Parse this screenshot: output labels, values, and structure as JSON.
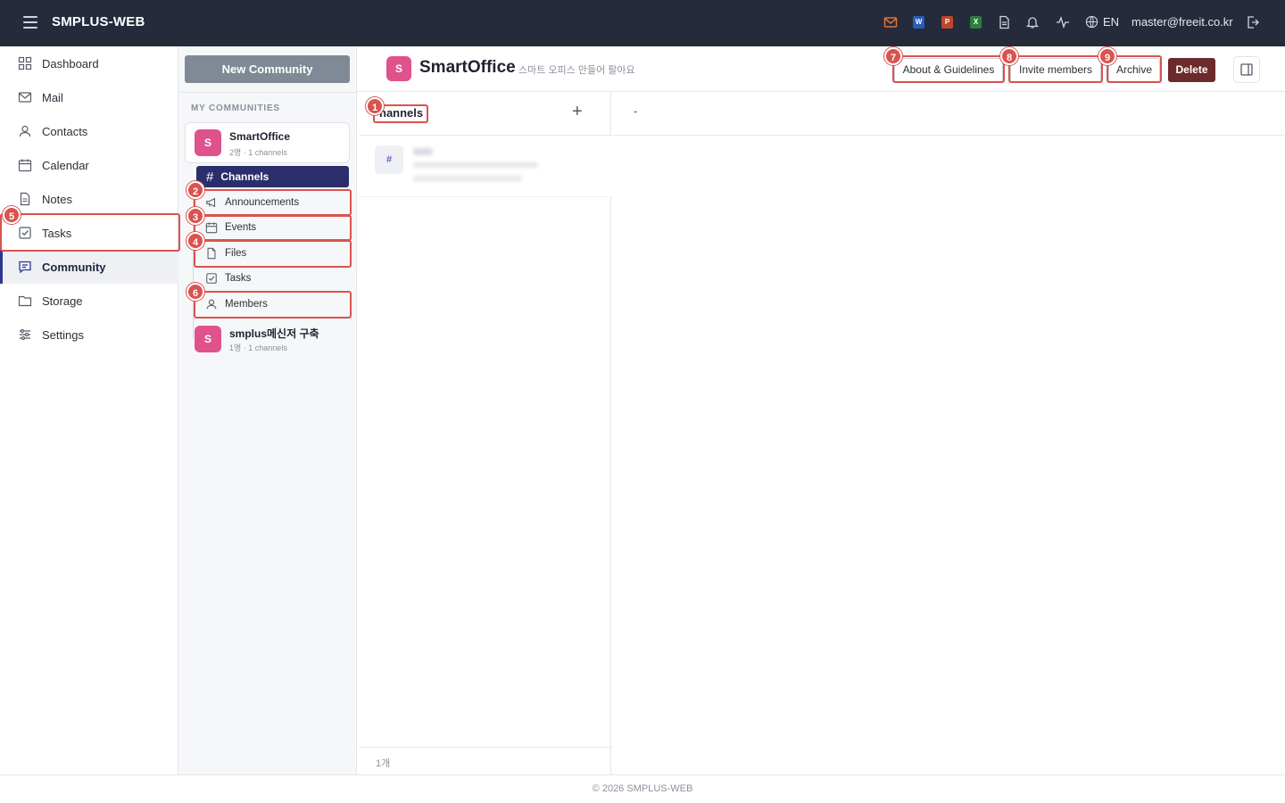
{
  "app": {
    "brand": "SMPLUS-WEB",
    "language": "EN",
    "user_email": "master@freeit.co.kr",
    "top_icons": [
      "mail-icon",
      "word-icon",
      "powerpoint-icon",
      "excel-icon",
      "document-icon",
      "bell-icon",
      "activity-icon",
      "globe-icon",
      "logout-icon"
    ],
    "office_badges": {
      "word": "W",
      "powerpoint": "P",
      "excel": "X"
    }
  },
  "sidebar": {
    "items": [
      {
        "label": "Dashboard",
        "icon": "grid-icon"
      },
      {
        "label": "Mail",
        "icon": "mail-icon"
      },
      {
        "label": "Contacts",
        "icon": "user-icon"
      },
      {
        "label": "Calendar",
        "icon": "calendar-icon"
      },
      {
        "label": "Notes",
        "icon": "note-icon"
      },
      {
        "label": "Tasks",
        "icon": "check-square-icon"
      },
      {
        "label": "Community",
        "icon": "chat-icon",
        "active": true
      },
      {
        "label": "Storage",
        "icon": "folder-icon"
      },
      {
        "label": "Settings",
        "icon": "sliders-icon"
      }
    ]
  },
  "community_list": {
    "new_button": "New Community",
    "section_label": "MY COMMUNITIES",
    "communities": [
      {
        "avatar": "S",
        "name": "SmartOffice",
        "meta": "2명 · 1 channels"
      },
      {
        "avatar": "S",
        "name": "smplus메신저 구축",
        "meta": "1명 · 1 channels"
      }
    ],
    "subnav": [
      {
        "label": "Channels",
        "icon": "hash-icon",
        "active": true
      },
      {
        "label": "Announcements",
        "icon": "megaphone-icon"
      },
      {
        "label": "Events",
        "icon": "calendar-icon"
      },
      {
        "label": "Files",
        "icon": "file-icon"
      },
      {
        "label": "Tasks",
        "icon": "check-square-icon"
      },
      {
        "label": "Members",
        "icon": "user-icon"
      }
    ]
  },
  "header": {
    "avatar": "S",
    "title": "SmartOffice",
    "description": "스마트 오피스 만들어 팔아요",
    "buttons": {
      "about": "About & Guidelines",
      "invite": "Invite members",
      "archive": "Archive",
      "delete": "Delete"
    }
  },
  "channels": {
    "title": "Channels",
    "title_visible": "hannels",
    "add": "+",
    "row_icon": "#",
    "count": "1개"
  },
  "detail": {
    "placeholder": "-"
  },
  "footer": {
    "text": "© 2026 SMPLUS-WEB"
  },
  "annotations": [
    "1",
    "2",
    "3",
    "4",
    "5",
    "6",
    "7",
    "8",
    "9"
  ],
  "colors": {
    "topbar": "#252b3b",
    "accent_navy": "#2a2f6b",
    "avatar_pink": "#e0528c",
    "delete": "#6d2a2a",
    "highlight": "#d9534f"
  }
}
